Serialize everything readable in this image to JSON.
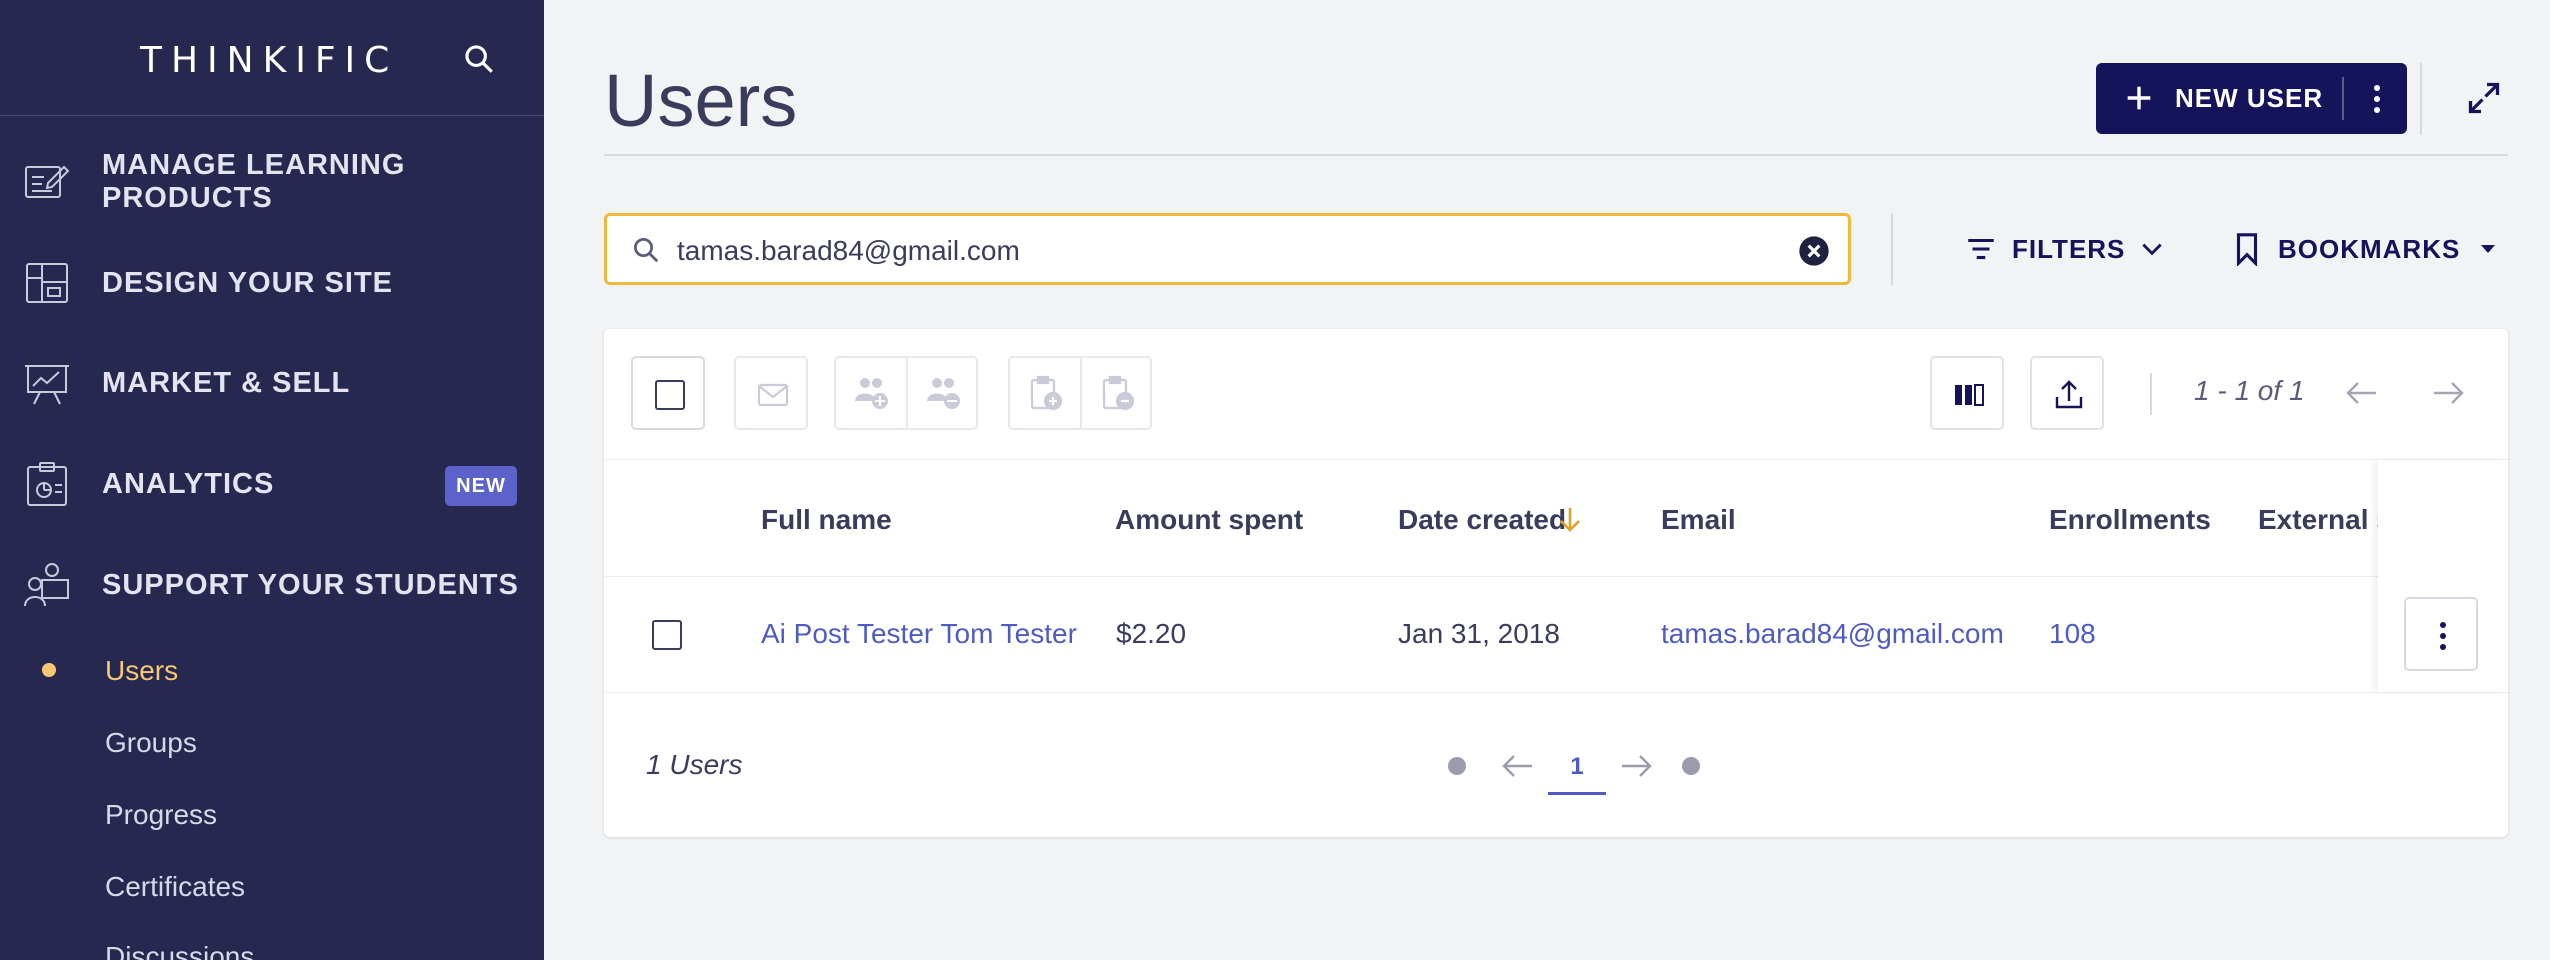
{
  "sidebar": {
    "logo": "THINKIFIC",
    "nav": [
      {
        "label": "MANAGE LEARNING PRODUCTS",
        "icon": "edit-document-icon"
      },
      {
        "label": "DESIGN YOUR SITE",
        "icon": "layout-icon"
      },
      {
        "label": "MARKET & SELL",
        "icon": "presentation-chart-icon"
      },
      {
        "label": "ANALYTICS",
        "icon": "analytics-clipboard-icon",
        "badge": "NEW"
      },
      {
        "label": "SUPPORT YOUR STUDENTS",
        "icon": "users-support-icon"
      }
    ],
    "sub_items": [
      {
        "label": "Users",
        "active": true
      },
      {
        "label": "Groups"
      },
      {
        "label": "Progress"
      },
      {
        "label": "Certificates"
      },
      {
        "label": "Discussions"
      }
    ]
  },
  "header": {
    "title": "Users",
    "new_user_label": "NEW USER"
  },
  "search": {
    "value": "tamas.barad84@gmail.com"
  },
  "filters_label": "FILTERS",
  "bookmarks_label": "BOOKMARKS",
  "toolbar": {
    "pager_text": "1 - 1 of 1"
  },
  "table": {
    "columns": [
      "Full name",
      "Amount spent",
      "Date created",
      "Email",
      "Enrollments",
      "External s"
    ],
    "rows": [
      {
        "full_name": "Ai Post Tester Tom Tester",
        "amount_spent": "$2.20",
        "date_created": "Jan 31, 2018",
        "email": "tamas.barad84@gmail.com",
        "enrollments": "108"
      }
    ]
  },
  "footer": {
    "count_text": "1 Users",
    "current_page": "1"
  },
  "colors": {
    "sidebar_bg": "#27284f",
    "primary_button": "#15135a",
    "search_border": "#f0b93c",
    "link": "#4f5bc4",
    "active_sub": "#f7c873",
    "badge": "#5b62c9"
  }
}
